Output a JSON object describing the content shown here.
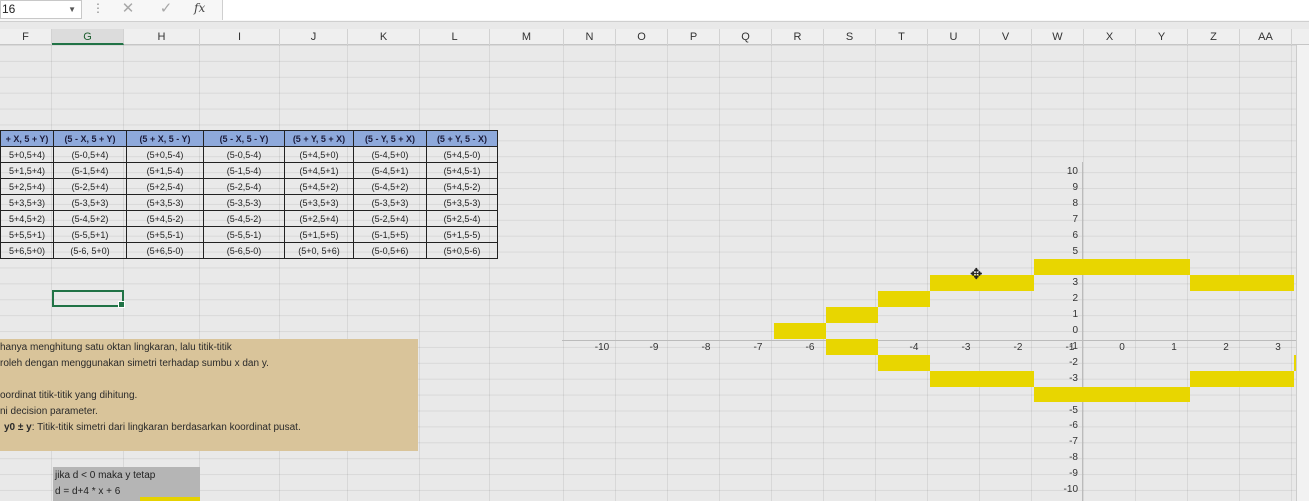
{
  "formula_bar": {
    "name_box": "16",
    "cancel_icon": "close-icon",
    "enter_icon": "check-icon",
    "fx_label": "fx",
    "content": ""
  },
  "columns": [
    "F",
    "G",
    "H",
    "I",
    "J",
    "K",
    "L",
    "M",
    "N",
    "O",
    "P",
    "Q",
    "R",
    "S",
    "T",
    "U",
    "V",
    "W",
    "X",
    "Y",
    "Z",
    "AA"
  ],
  "selected_column": "G",
  "table": {
    "headers": [
      "+ X, 5 + Y)",
      "(5 - X, 5 + Y)",
      "(5 + X, 5 - Y)",
      "(5 - X, 5 - Y)",
      "(5 + Y, 5 + X)",
      "(5 - Y, 5 + X)",
      "(5 + Y, 5 - X)"
    ],
    "rows": [
      [
        "5+0,5+4)",
        "(5-0,5+4)",
        "(5+0,5-4)",
        "(5-0,5-4)",
        "(5+4,5+0)",
        "(5-4,5+0)",
        "(5+4,5-0)"
      ],
      [
        "5+1,5+4)",
        "(5-1,5+4)",
        "(5+1,5-4)",
        "(5-1,5-4)",
        "(5+4,5+1)",
        "(5-4,5+1)",
        "(5+4,5-1)"
      ],
      [
        "5+2,5+4)",
        "(5-2,5+4)",
        "(5+2,5-4)",
        "(5-2,5-4)",
        "(5+4,5+2)",
        "(5-4,5+2)",
        "(5+4,5-2)"
      ],
      [
        "5+3,5+3)",
        "(5-3,5+3)",
        "(5+3,5-3)",
        "(5-3,5-3)",
        "(5+3,5+3)",
        "(5-3,5+3)",
        "(5+3,5-3)"
      ],
      [
        "5+4,5+2)",
        "(5-4,5+2)",
        "(5+4,5-2)",
        "(5-4,5-2)",
        "(5+2,5+4)",
        "(5-2,5+4)",
        "(5+2,5-4)"
      ],
      [
        "5+5,5+1)",
        "(5-5,5+1)",
        "(5+5,5-1)",
        "(5-5,5-1)",
        "(5+1,5+5)",
        "(5-1,5+5)",
        "(5+1,5-5)"
      ],
      [
        "5+6,5+0)",
        "(5-6, 5+0)",
        "(5+6,5-0)",
        "(5-6,5-0)",
        "(5+0, 5+6)",
        "(5-0,5+6)",
        "(5+0,5-6)"
      ]
    ]
  },
  "note_lines": [
    "hanya menghitung satu oktan lingkaran, lalu titik-titik",
    "roleh dengan menggunakan simetri terhadap sumbu x dan y.",
    "",
    "oordinat titik-titik yang dihitung.",
    "ni decision parameter.",
    "y0 ± y: Titik-titik simetri dari lingkaran berdasarkan koordinat pusat."
  ],
  "note_bold_prefix": "y0 ± y",
  "note_last_rest": ": Titik-titik simetri dari lingkaran berdasarkan koordinat pusat.",
  "condition_box": [
    "jika d < 0 maka y tetap",
    "d = d+4 * x + 6"
  ],
  "axis": {
    "y_labels": [
      "10",
      "9",
      "8",
      "7",
      "6",
      "5",
      "4",
      "3",
      "2",
      "1",
      "0",
      "-1",
      "-2",
      "-3",
      "-4",
      "-5",
      "-6",
      "-7",
      "-8",
      "-9",
      "-10"
    ],
    "x_labels": [
      "-10",
      "-9",
      "-8",
      "-7",
      "-6",
      "-5",
      "-4",
      "-3",
      "-2",
      "-1",
      "0",
      "1",
      "2",
      "3"
    ]
  },
  "highlight_color": "#e8d600"
}
